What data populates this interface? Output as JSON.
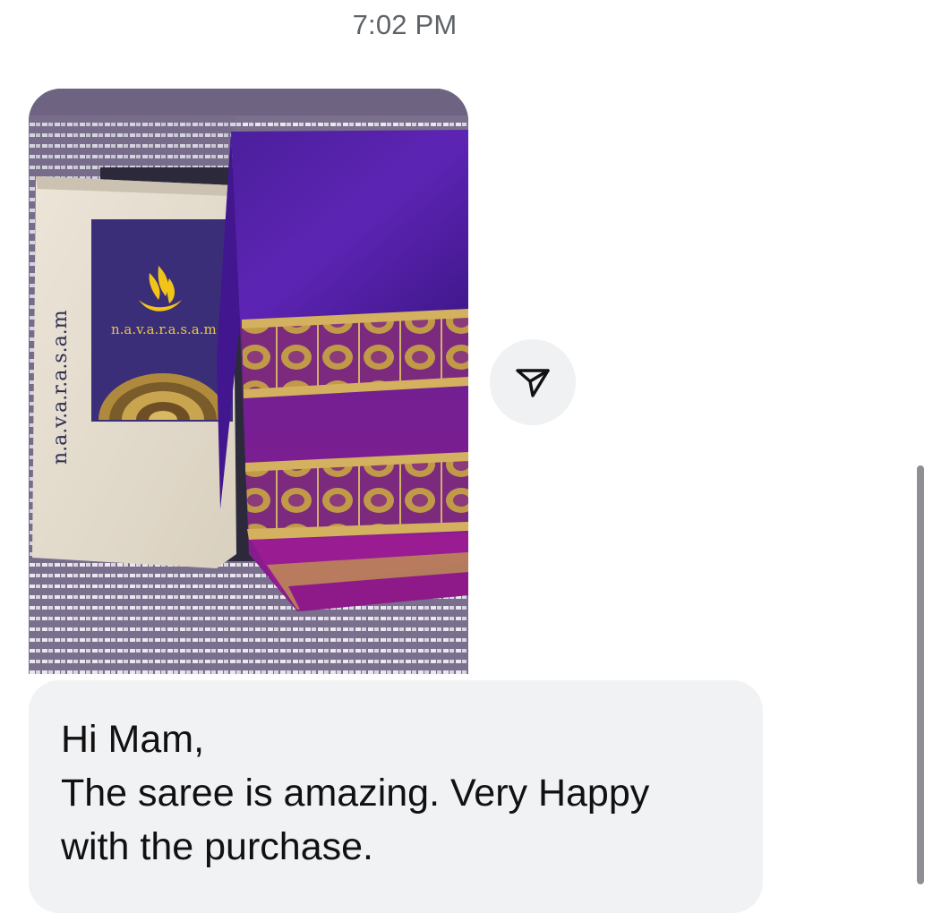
{
  "thread": {
    "timestamp": "7:02 PM"
  },
  "photo_message": {
    "brand_text_bag": "n.a.v.a.r.a.s.a.m",
    "brand_text_card": "n.a.v.a.r.a.s.a.m"
  },
  "share_button": {
    "icon": "send-icon"
  },
  "text_message": {
    "lines": [
      "Hi Mam,",
      "The saree is amazing. Very Happy",
      "with the purchase."
    ]
  },
  "colors": {
    "bubble_bg": "#f1f2f4",
    "share_bg": "#f0f1f3",
    "saree_purple": "#5a1fa8",
    "saree_magenta": "#8a1a8c",
    "zari_gold": "#c9a24a"
  }
}
